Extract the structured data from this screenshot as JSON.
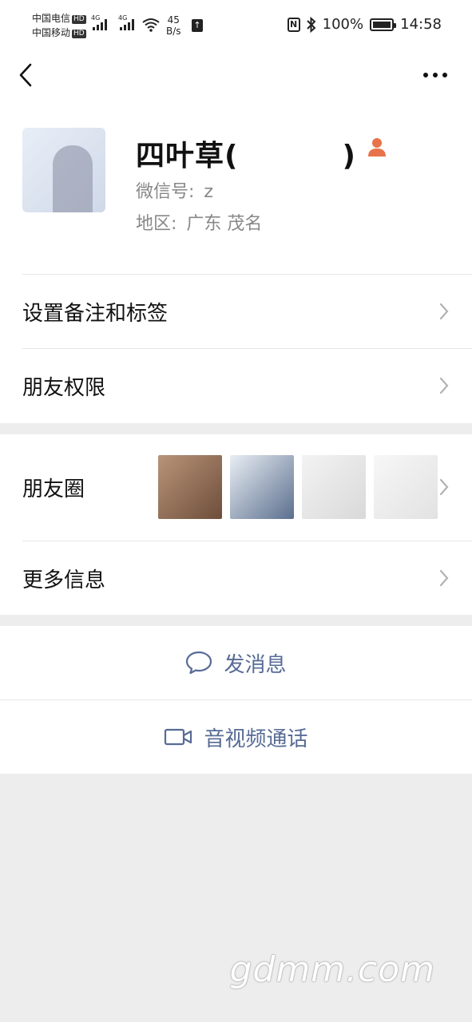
{
  "status_bar": {
    "carrier1": "中国电信",
    "carrier2": "中国移动",
    "hd": "HD",
    "net1": "4G",
    "net2": "4G",
    "wifi_tag": "6",
    "speed_value": "45",
    "speed_unit": "B/s",
    "nfc_label": "N",
    "battery": "100%",
    "time": "14:58"
  },
  "profile": {
    "name": "四叶草(",
    "name_close": ")",
    "wechat_id_label": "微信号:",
    "wechat_id_value": "z",
    "region_label": "地区:",
    "region_value": "广东  茂名"
  },
  "menu": {
    "remark_tags": "设置备注和标签",
    "friend_permissions": "朋友权限",
    "moments": "朋友圈",
    "more_info": "更多信息"
  },
  "actions": {
    "send_message": "发消息",
    "av_call": "音视频通话"
  },
  "watermark": "gdmm.com",
  "colors": {
    "link_blue": "#576b95",
    "badge_orange": "#e8734a",
    "background": "#ededed"
  }
}
